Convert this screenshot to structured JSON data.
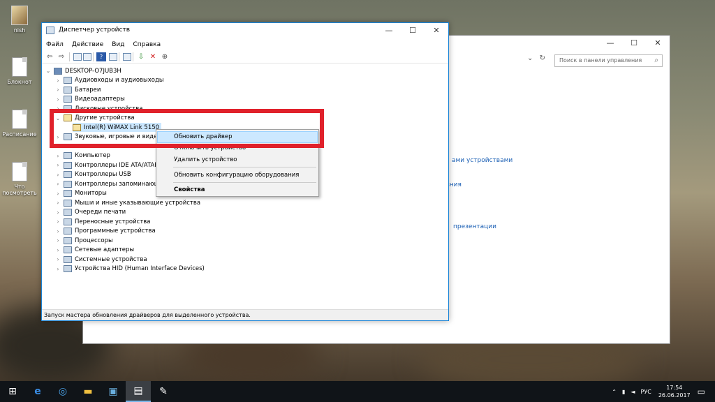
{
  "desktop": {
    "icons": [
      {
        "label": "nish"
      },
      {
        "label": "Блокнот"
      },
      {
        "label": "Расписание"
      },
      {
        "label": "Что посмотреть"
      }
    ]
  },
  "control_panel": {
    "search_placeholder": "Поиск в панели управления",
    "links": [
      "ами устройствами",
      "зния",
      "презентации"
    ]
  },
  "device_manager": {
    "title": "Диспетчер устройств",
    "menu": [
      "Файл",
      "Действие",
      "Вид",
      "Справка"
    ],
    "root": "DESKTOP-O7JUB3H",
    "tree": [
      "Аудиовходы и аудиовыходы",
      "Батареи",
      "Видеоадаптеры",
      "Дисковые устройства",
      "Другие устройства",
      "Intel(R) WiMAX Link 5150",
      "Звуковые, игровые и видеоустройства",
      "Компьютер",
      "Контроллеры IDE ATA/ATAPI",
      "Контроллеры USB",
      "Контроллеры запоминающих устройств",
      "Мониторы",
      "Мыши и иные указывающие устройства",
      "Очереди печати",
      "Переносные устройства",
      "Программные устройства",
      "Процессоры",
      "Сетевые адаптеры",
      "Системные устройства",
      "Устройства HID (Human Interface Devices)"
    ],
    "status": "Запуск мастера обновления драйверов для выделенного устройства."
  },
  "context_menu": {
    "items": [
      "Обновить драйвер",
      "Отключить устройство",
      "Удалить устройство",
      "Обновить конфигурацию оборудования",
      "Свойства"
    ]
  },
  "taskbar": {
    "language": "РУС",
    "time": "17:54",
    "date": "26.06.2017"
  },
  "colors": {
    "accent": "#1883d7",
    "annotation": "#e0212b",
    "menu_highlight": "#cce8ff",
    "link": "#1a5fb4"
  }
}
